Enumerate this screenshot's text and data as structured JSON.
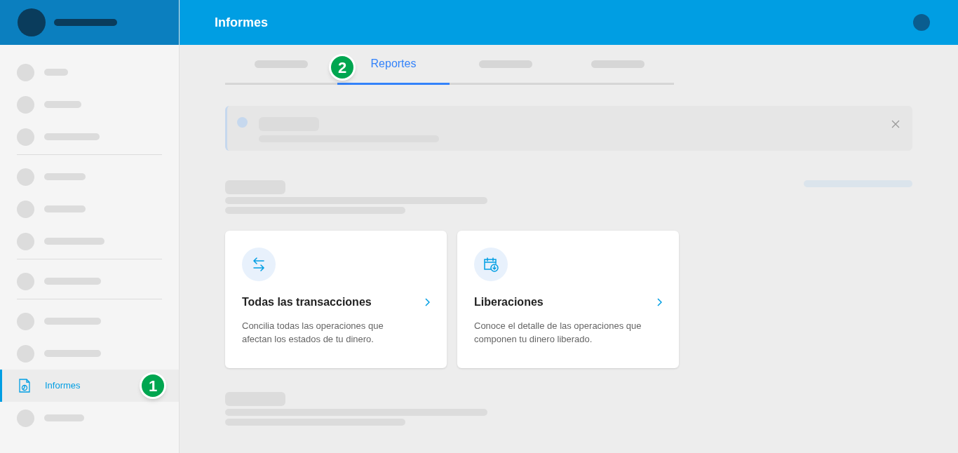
{
  "header": {
    "title": "Informes"
  },
  "sidebar": {
    "groups": [
      {
        "items": [
          {
            "kind": "skeleton"
          },
          {
            "kind": "skeleton"
          },
          {
            "kind": "skeleton"
          }
        ]
      },
      {
        "items": [
          {
            "kind": "skeleton"
          },
          {
            "kind": "skeleton"
          },
          {
            "kind": "skeleton"
          }
        ]
      },
      {
        "items": [
          {
            "kind": "skeleton"
          }
        ]
      },
      {
        "items": [
          {
            "kind": "skeleton"
          },
          {
            "kind": "skeleton"
          },
          {
            "kind": "link",
            "label": "Informes",
            "selected": true,
            "badge": "1"
          },
          {
            "kind": "skeleton"
          }
        ]
      }
    ]
  },
  "tabs": [
    {
      "kind": "skeleton",
      "selected": false
    },
    {
      "kind": "label",
      "label": "Reportes",
      "selected": true,
      "badge": "2"
    },
    {
      "kind": "skeleton",
      "selected": false
    },
    {
      "kind": "skeleton",
      "selected": false
    }
  ],
  "cards": [
    {
      "kind": "transfer",
      "title": "Todas las transacciones",
      "description": "Concilia todas las operaciones que afectan los estados de tu dinero."
    },
    {
      "kind": "release",
      "title": "Liberaciones",
      "description": "Conoce el detalle de las operaciones que componen tu dinero liberado."
    }
  ]
}
